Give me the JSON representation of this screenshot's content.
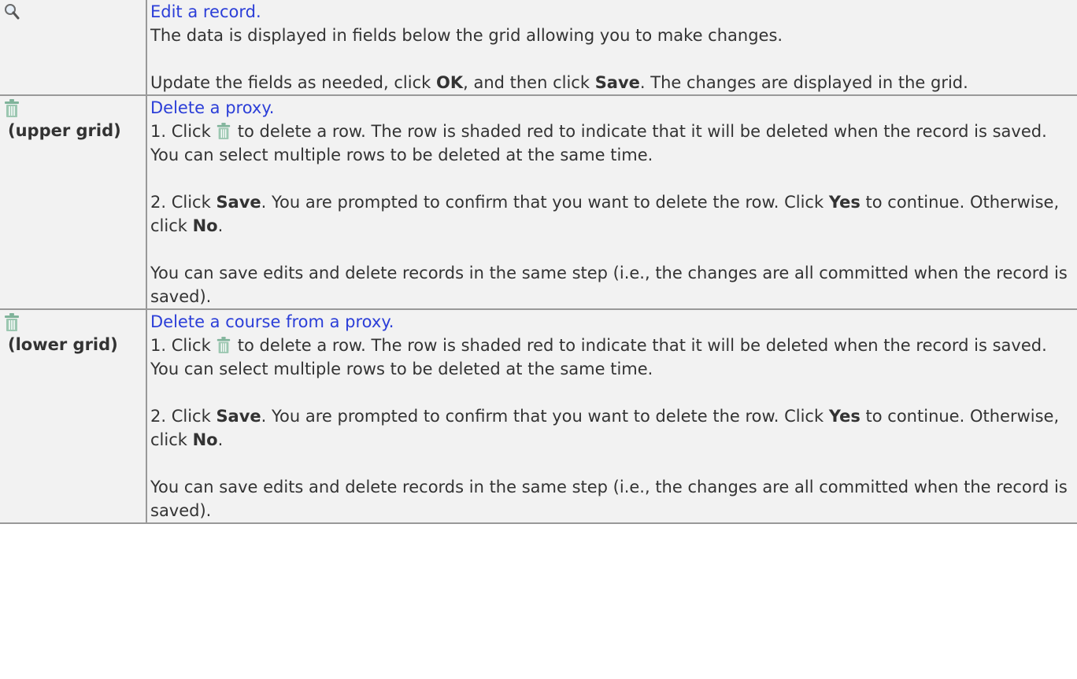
{
  "rows": [
    {
      "icon": "magnifier-icon",
      "link": "Edit a record.",
      "line1": "The data is displayed in fields below the grid allowing you to make changes.",
      "p2_pre": "Update the fields as needed, click ",
      "p2_ok": "OK",
      "p2_mid": ", and then click ",
      "p2_save": "Save",
      "p2_post": ". The changes are displayed in the grid."
    },
    {
      "icon": "trash-icon",
      "note": "(upper grid)",
      "link": "Delete a proxy.",
      "s1_pre": "1. Click",
      "s1_post": "to delete a row. The row is shaded red to indicate that it will be deleted when the record is saved. You can select multiple rows to be deleted at the same time.",
      "s2_pre": "2. Click ",
      "s2_save": "Save",
      "s2_mid": ". You are prompted to confirm that you want to delete the row. Click ",
      "s2_yes": "Yes",
      "s2_mid2": " to continue. Otherwise, click ",
      "s2_no": "No",
      "s2_post": ".",
      "s3": "You can save edits and delete records in the same step (i.e., the changes are all committed when the record is saved)."
    },
    {
      "icon": "trash-icon",
      "note": "(lower grid)",
      "link": "Delete a course from a proxy.",
      "s1_pre": "1. Click",
      "s1_post": "to delete a row. The row is shaded red to indicate that it will be deleted when the record is saved. You can select multiple rows to be deleted at the same time.",
      "s2_pre": "2. Click ",
      "s2_save": "Save",
      "s2_mid": ". You are prompted to confirm that you want to delete the row. Click ",
      "s2_yes": "Yes",
      "s2_mid2": " to continue. Otherwise, click ",
      "s2_no": "No",
      "s2_post": ".",
      "s3": "You can save edits and delete records in the same step (i.e., the changes are all committed when the record is saved)."
    }
  ],
  "colors": {
    "link": "#2b3ed8",
    "cell_bg": "#f2f2f2",
    "border": "#999999",
    "text": "#333333",
    "trash_icon": "#7fb39a"
  }
}
